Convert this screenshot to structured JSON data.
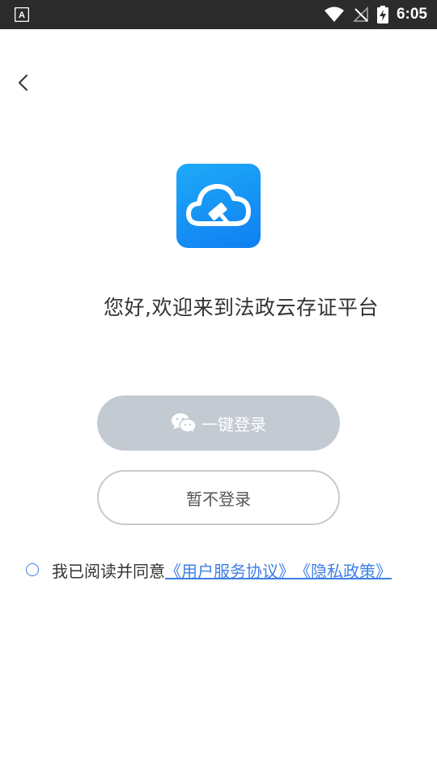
{
  "status_bar": {
    "time": "6:05"
  },
  "nav": {
    "back_icon": "chevron-left-icon"
  },
  "logo": {
    "icon": "cloud-gavel-icon",
    "gradient_from": "#1eaaf8",
    "gradient_to": "#0f7ff2"
  },
  "welcome_text": "您好,欢迎来到法政云存证平台",
  "buttons": {
    "wechat_login": "一键登录",
    "wechat_icon": "wechat-icon",
    "wechat_bg": "#c3cad2",
    "skip_login": "暂不登录"
  },
  "agreement": {
    "prefix": "我已阅读并同意",
    "user_agreement": "《用户服务协议》",
    "privacy_policy": "《隐私政策》",
    "link_color": "#3f7fe6"
  }
}
